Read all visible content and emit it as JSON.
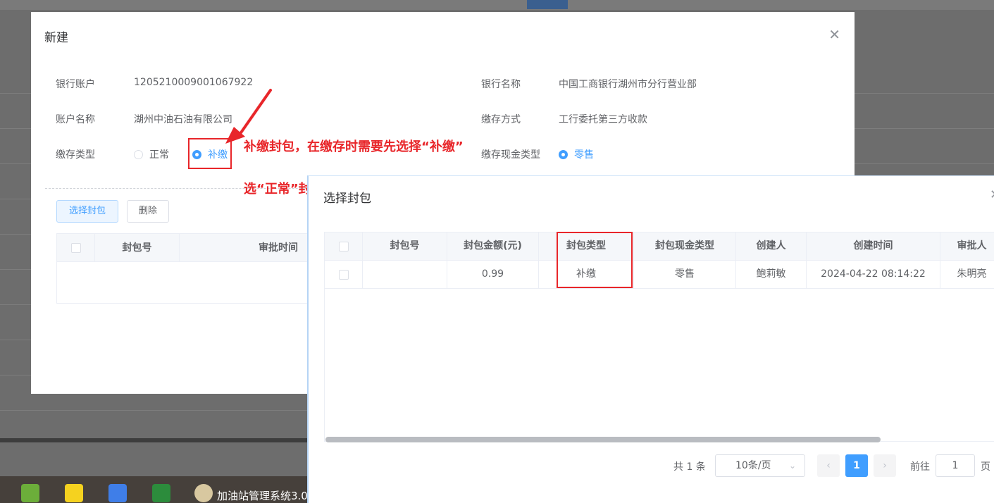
{
  "main_dialog": {
    "title": "新建",
    "fields": {
      "bank_account_label": "银行账户",
      "bank_account_value": "1205210009001067922",
      "bank_name_label": "银行名称",
      "bank_name_value": "中国工商银行湖州市分行营业部",
      "account_name_label": "账户名称",
      "account_name_value": "湖州中油石油有限公司",
      "deposit_method_label": "缴存方式",
      "deposit_method_value": "工行委托第三方收款",
      "deposit_type_label": "缴存类型",
      "deposit_type_options": [
        "正常",
        "补缴"
      ],
      "cash_type_label": "缴存现金类型",
      "cash_type_option": "零售"
    },
    "buttons": {
      "select_package": "选择封包",
      "delete": "删除"
    },
    "table_headers": [
      "封包号",
      "审批时间"
    ]
  },
  "annotation": {
    "line1": "补缴封包，在缴存时需要先选择“补缴”",
    "line2": "选“正常”封包，选择不到。",
    "color": "#e8262a"
  },
  "pick_dialog": {
    "title": "选择封包",
    "headers": [
      "封包号",
      "封包金额(元)",
      "封包类型",
      "封包现金类型",
      "创建人",
      "创建时间",
      "审批人"
    ],
    "rows": [
      [
        "",
        "0.99",
        "补缴",
        "零售",
        "鲍莉敏",
        "2024-04-22 08:14:22",
        "朱明亮"
      ]
    ],
    "pagination": {
      "total": "共 1 条",
      "page_size": "10条/页",
      "current_page": "1",
      "goto_label": "前往",
      "goto_value": "1",
      "page_suffix": "页"
    }
  },
  "taskbar": {
    "window_title": "加油站管理系统3.0",
    "icons": [
      "checkmark-app-icon",
      "player-app-icon",
      "wps-app-icon",
      "remote-desktop-icon",
      "app-window-icon"
    ]
  },
  "colors": {
    "primary": "#409eff",
    "annotation_red": "#e8262a"
  }
}
